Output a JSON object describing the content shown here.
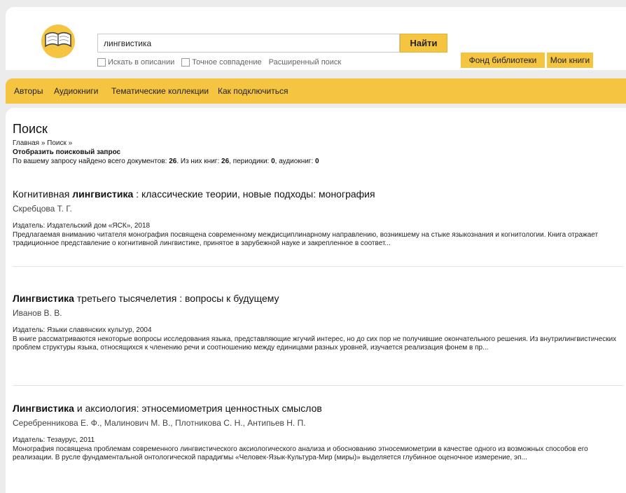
{
  "search": {
    "query": "лингвистика",
    "button_label": "Найти",
    "option_description": "Искать в описании",
    "option_exact": "Точное совпадение",
    "advanced_label": "Расширенный поиск"
  },
  "header_buttons": {
    "fund": "Фонд библиотеки",
    "my_books": "Мои книги"
  },
  "nav": {
    "items": [
      {
        "label": "Авторы"
      },
      {
        "label": "Аудиокниги"
      },
      {
        "label": "Тематические коллекции"
      },
      {
        "label": "Как подключиться"
      }
    ]
  },
  "page": {
    "title": "Поиск",
    "breadcrumb": "Главная » Поиск »",
    "show_query": "Отобразить поисковый запрос",
    "summary": {
      "prefix": "По вашему запросу найдено всего документов: ",
      "total": "26",
      "books_prefix": ". Из них книг: ",
      "books": "26",
      "periodicals_prefix": ", периодики: ",
      "periodicals": "0",
      "audio_prefix": ", аудиокниг: ",
      "audio": "0"
    }
  },
  "results": [
    {
      "title_pre": "Когнитивная ",
      "title_hl": "лингвистика",
      "title_post": " : классические теории, новые подходы: монография",
      "author": "Скребцова Т. Г.",
      "publisher": "Издатель: Издательский дом «ЯСК», 2018",
      "description": "Предлагаемая вниманию читателя монография посвящена современному междисциплинарному направлению, возникшему на стыке языкознания и когнитологии. Книга отражает традиционное представление о когнитивной лингвистике, принятое в зарубежной науке и закрепленное в соответ..."
    },
    {
      "title_pre": "",
      "title_hl": "Лингвистика",
      "title_post": " третьего тысячелетия : вопросы к будущему",
      "author": "Иванов В. В.",
      "publisher": "Издатель: Языки славянских культур, 2004",
      "description": "В книге рассматриваются некоторые вопросы исследования языка, представляющие жгучий интерес, но до сих пор не получившие окончательного решения. Из внутрилингвистических проблем структуры языка, относящихся к членению речи и соотношению между единицами разных уровней, изучается реализация фонем в пр..."
    },
    {
      "title_pre": "",
      "title_hl": "Лингвистика",
      "title_post": " и аксиология: этносемиометрия ценностных смыслов",
      "author": "Серебренникова Е. Ф., Малинович М. В., Плотникова С. Н., Антипьев Н. П.",
      "publisher": "Издатель: Тезаурус, 2011",
      "description": "Монография посвящена проблемам современного лингвистического аксиологического анализа и обоснованию этносемиометрии в качестве одного из возможных способов его реализации. В русле фундаментальной онтологической парадигмы «Человек-Язык-Культура-Мир (миры)» выделяется глубинное оценочное измерение, эп..."
    }
  ],
  "colors": {
    "accent": "#f5c542",
    "background": "#ececec"
  },
  "icons": {
    "logo": "open-book-logo-icon"
  }
}
